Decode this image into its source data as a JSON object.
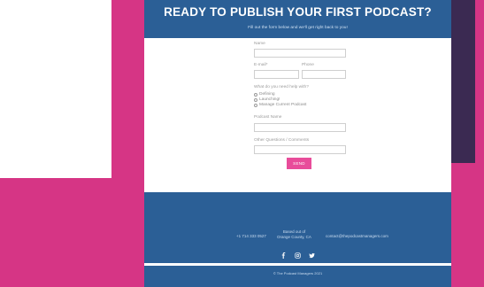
{
  "header": {
    "title": "READY TO PUBLISH YOUR FIRST PODCAST?",
    "subtitle": "Fill out the form below and we'll get right back to you!"
  },
  "form": {
    "name_label": "Name",
    "email_label": "E-mail*",
    "phone_label": "Phone",
    "help_label": "What do you need help with?",
    "options": [
      "Defining",
      "Launching!",
      "Manage Current Podcast"
    ],
    "podcast_name_label": "Podcast Name",
    "questions_label": "Other Questions / Comments",
    "send_label": "SEND"
  },
  "footer": {
    "phone": "+1 714 333 0527",
    "based_line1": "Based out of",
    "based_line2": "Orange County, CA",
    "email": "contact@thepodcastmanagers.com",
    "copyright": "© The Podcast Managers 2021"
  },
  "social": [
    "facebook-icon",
    "instagram-icon",
    "twitter-icon"
  ],
  "colors": {
    "background_pink": "#d63585",
    "dark_panel": "#3b2a52",
    "primary_blue": "#2b5f96",
    "button_pink": "#e84c9a"
  }
}
